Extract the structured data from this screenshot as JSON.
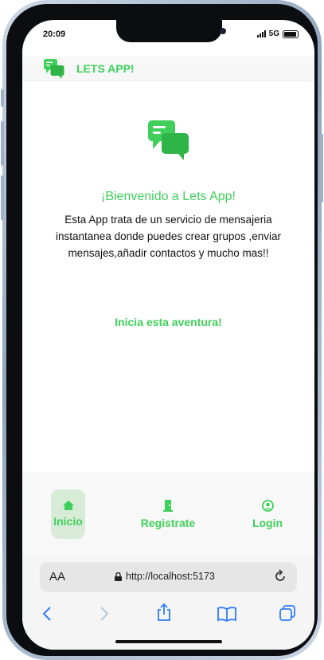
{
  "status": {
    "time": "20:09",
    "network": "5G"
  },
  "app": {
    "title": "LETS APP!",
    "accent": "#3fcf5a"
  },
  "hero": {
    "welcome": "¡Bienvenido a Lets App!",
    "description": "Esta App trata de un servicio de mensajeria instantanea donde puedes crear grupos ,enviar mensajes,añadir contactos y mucho mas!!",
    "cta": "Inicia esta aventura!"
  },
  "nav": {
    "items": [
      {
        "label": "Inicio",
        "icon": "home-icon",
        "active": true
      },
      {
        "label": "Registrate",
        "icon": "door-icon",
        "active": false
      },
      {
        "label": "Login",
        "icon": "user-circle-icon",
        "active": false
      }
    ]
  },
  "browser": {
    "text_size_label": "AA",
    "url": "http://localhost:5173"
  }
}
